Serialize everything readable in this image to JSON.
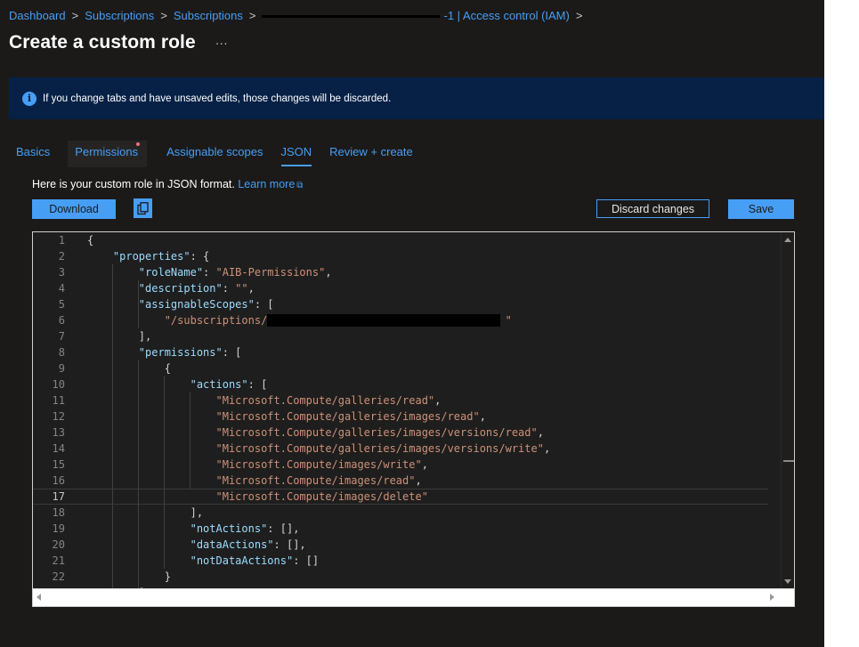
{
  "breadcrumb": [
    {
      "label": "Dashboard"
    },
    {
      "label": "Subscriptions"
    },
    {
      "label": "Subscriptions"
    },
    {
      "label": "-1 | Access control (IAM)"
    }
  ],
  "page": {
    "title": "Create a custom role",
    "more": "···"
  },
  "banner": {
    "text": "If you change tabs and have unsaved edits, those changes will be discarded.",
    "icon": "info-icon"
  },
  "tabs": [
    {
      "label": "Basics"
    },
    {
      "label": "Permissions"
    },
    {
      "label": "Assignable scopes"
    },
    {
      "label": "JSON"
    },
    {
      "label": "Review + create"
    }
  ],
  "active_tab": "JSON",
  "intro": {
    "text": "Here is your custom role in JSON format.",
    "link": "Learn more"
  },
  "toolbar": {
    "download": "Download",
    "discard": "Discard changes",
    "save": "Save",
    "copy_icon": "copy-icon"
  },
  "editor": {
    "current_line": 17,
    "lines": [
      [
        [
          "p",
          "{"
        ]
      ],
      [
        [
          "p",
          "    "
        ],
        [
          "k",
          "\"properties\""
        ],
        [
          "p",
          ": {"
        ]
      ],
      [
        [
          "p",
          "        "
        ],
        [
          "k",
          "\"roleName\""
        ],
        [
          "p",
          ": "
        ],
        [
          "s",
          "\"AIB-Permissions\""
        ],
        [
          "p",
          ","
        ]
      ],
      [
        [
          "p",
          "        "
        ],
        [
          "k",
          "\"description\""
        ],
        [
          "p",
          ": "
        ],
        [
          "s",
          "\"\""
        ],
        [
          "p",
          ","
        ]
      ],
      [
        [
          "p",
          "        "
        ],
        [
          "k",
          "\"assignableScopes\""
        ],
        [
          "p",
          ": ["
        ]
      ],
      [
        [
          "p",
          "            "
        ],
        [
          "s",
          "\"/subscriptions/"
        ],
        [
          "p",
          "                                     "
        ],
        [
          "s",
          "\""
        ]
      ],
      [
        [
          "p",
          "        ],"
        ]
      ],
      [
        [
          "p",
          "        "
        ],
        [
          "k",
          "\"permissions\""
        ],
        [
          "p",
          ": ["
        ]
      ],
      [
        [
          "p",
          "            {"
        ]
      ],
      [
        [
          "p",
          "                "
        ],
        [
          "k",
          "\"actions\""
        ],
        [
          "p",
          ": ["
        ]
      ],
      [
        [
          "p",
          "                    "
        ],
        [
          "s",
          "\"Microsoft.Compute/galleries/read\""
        ],
        [
          "p",
          ","
        ]
      ],
      [
        [
          "p",
          "                    "
        ],
        [
          "s",
          "\"Microsoft.Compute/galleries/images/read\""
        ],
        [
          "p",
          ","
        ]
      ],
      [
        [
          "p",
          "                    "
        ],
        [
          "s",
          "\"Microsoft.Compute/galleries/images/versions/read\""
        ],
        [
          "p",
          ","
        ]
      ],
      [
        [
          "p",
          "                    "
        ],
        [
          "s",
          "\"Microsoft.Compute/galleries/images/versions/write\""
        ],
        [
          "p",
          ","
        ]
      ],
      [
        [
          "p",
          "                    "
        ],
        [
          "s",
          "\"Microsoft.Compute/images/write\""
        ],
        [
          "p",
          ","
        ]
      ],
      [
        [
          "p",
          "                    "
        ],
        [
          "s",
          "\"Microsoft.Compute/images/read\""
        ],
        [
          "p",
          ","
        ]
      ],
      [
        [
          "p",
          "                    "
        ],
        [
          "s",
          "\"Microsoft.Compute/images/delete\""
        ]
      ],
      [
        [
          "p",
          "                ],"
        ]
      ],
      [
        [
          "p",
          "                "
        ],
        [
          "k",
          "\"notActions\""
        ],
        [
          "p",
          ": [],"
        ]
      ],
      [
        [
          "p",
          "                "
        ],
        [
          "k",
          "\"dataActions\""
        ],
        [
          "p",
          ": [],"
        ]
      ],
      [
        [
          "p",
          "                "
        ],
        [
          "k",
          "\"notDataActions\""
        ],
        [
          "p",
          ": []"
        ]
      ],
      [
        [
          "p",
          "            }"
        ]
      ],
      [
        [
          "p",
          "        ]"
        ]
      ]
    ]
  }
}
